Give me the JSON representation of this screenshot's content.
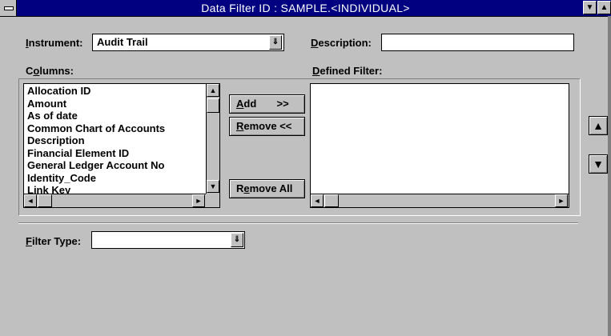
{
  "window": {
    "title": "Data Filter ID : SAMPLE.<INDIVIDUAL>"
  },
  "titlebar_icons": {
    "system": "system-menu-icon",
    "minimize": "▼",
    "maximize": "▲"
  },
  "instrument": {
    "label_accel": "I",
    "label_rest": "nstrument:",
    "value": "Audit Trail",
    "dropdown_glyph": "⇓"
  },
  "description": {
    "label_accel": "D",
    "label_rest": "escription:",
    "value": ""
  },
  "columns": {
    "label_pre": "C",
    "label_accel": "o",
    "label_rest": "lumns:",
    "items": [
      "Allocation ID",
      "Amount",
      "As of date",
      "Common Chart of Accounts",
      "Description",
      "Financial Element ID",
      "General Ledger Account No",
      "Identity_Code",
      "Link Key"
    ]
  },
  "defined_filter": {
    "label_accel": "D",
    "label_rest": "efined Filter:",
    "items": []
  },
  "buttons": {
    "add": {
      "accel": "A",
      "rest": "dd       >>"
    },
    "remove": {
      "accel": "R",
      "rest": "emove <<"
    },
    "remove_all": {
      "pre": "R",
      "accel": "e",
      "rest": "move All"
    }
  },
  "move_buttons": {
    "up": "▲",
    "down": "▼"
  },
  "scroll_glyphs": {
    "up": "▲",
    "down": "▼",
    "left": "◄",
    "right": "►"
  },
  "filter_type": {
    "label_accel": "F",
    "label_rest": "ilter Type:",
    "value": "",
    "dropdown_glyph": "⇓"
  }
}
